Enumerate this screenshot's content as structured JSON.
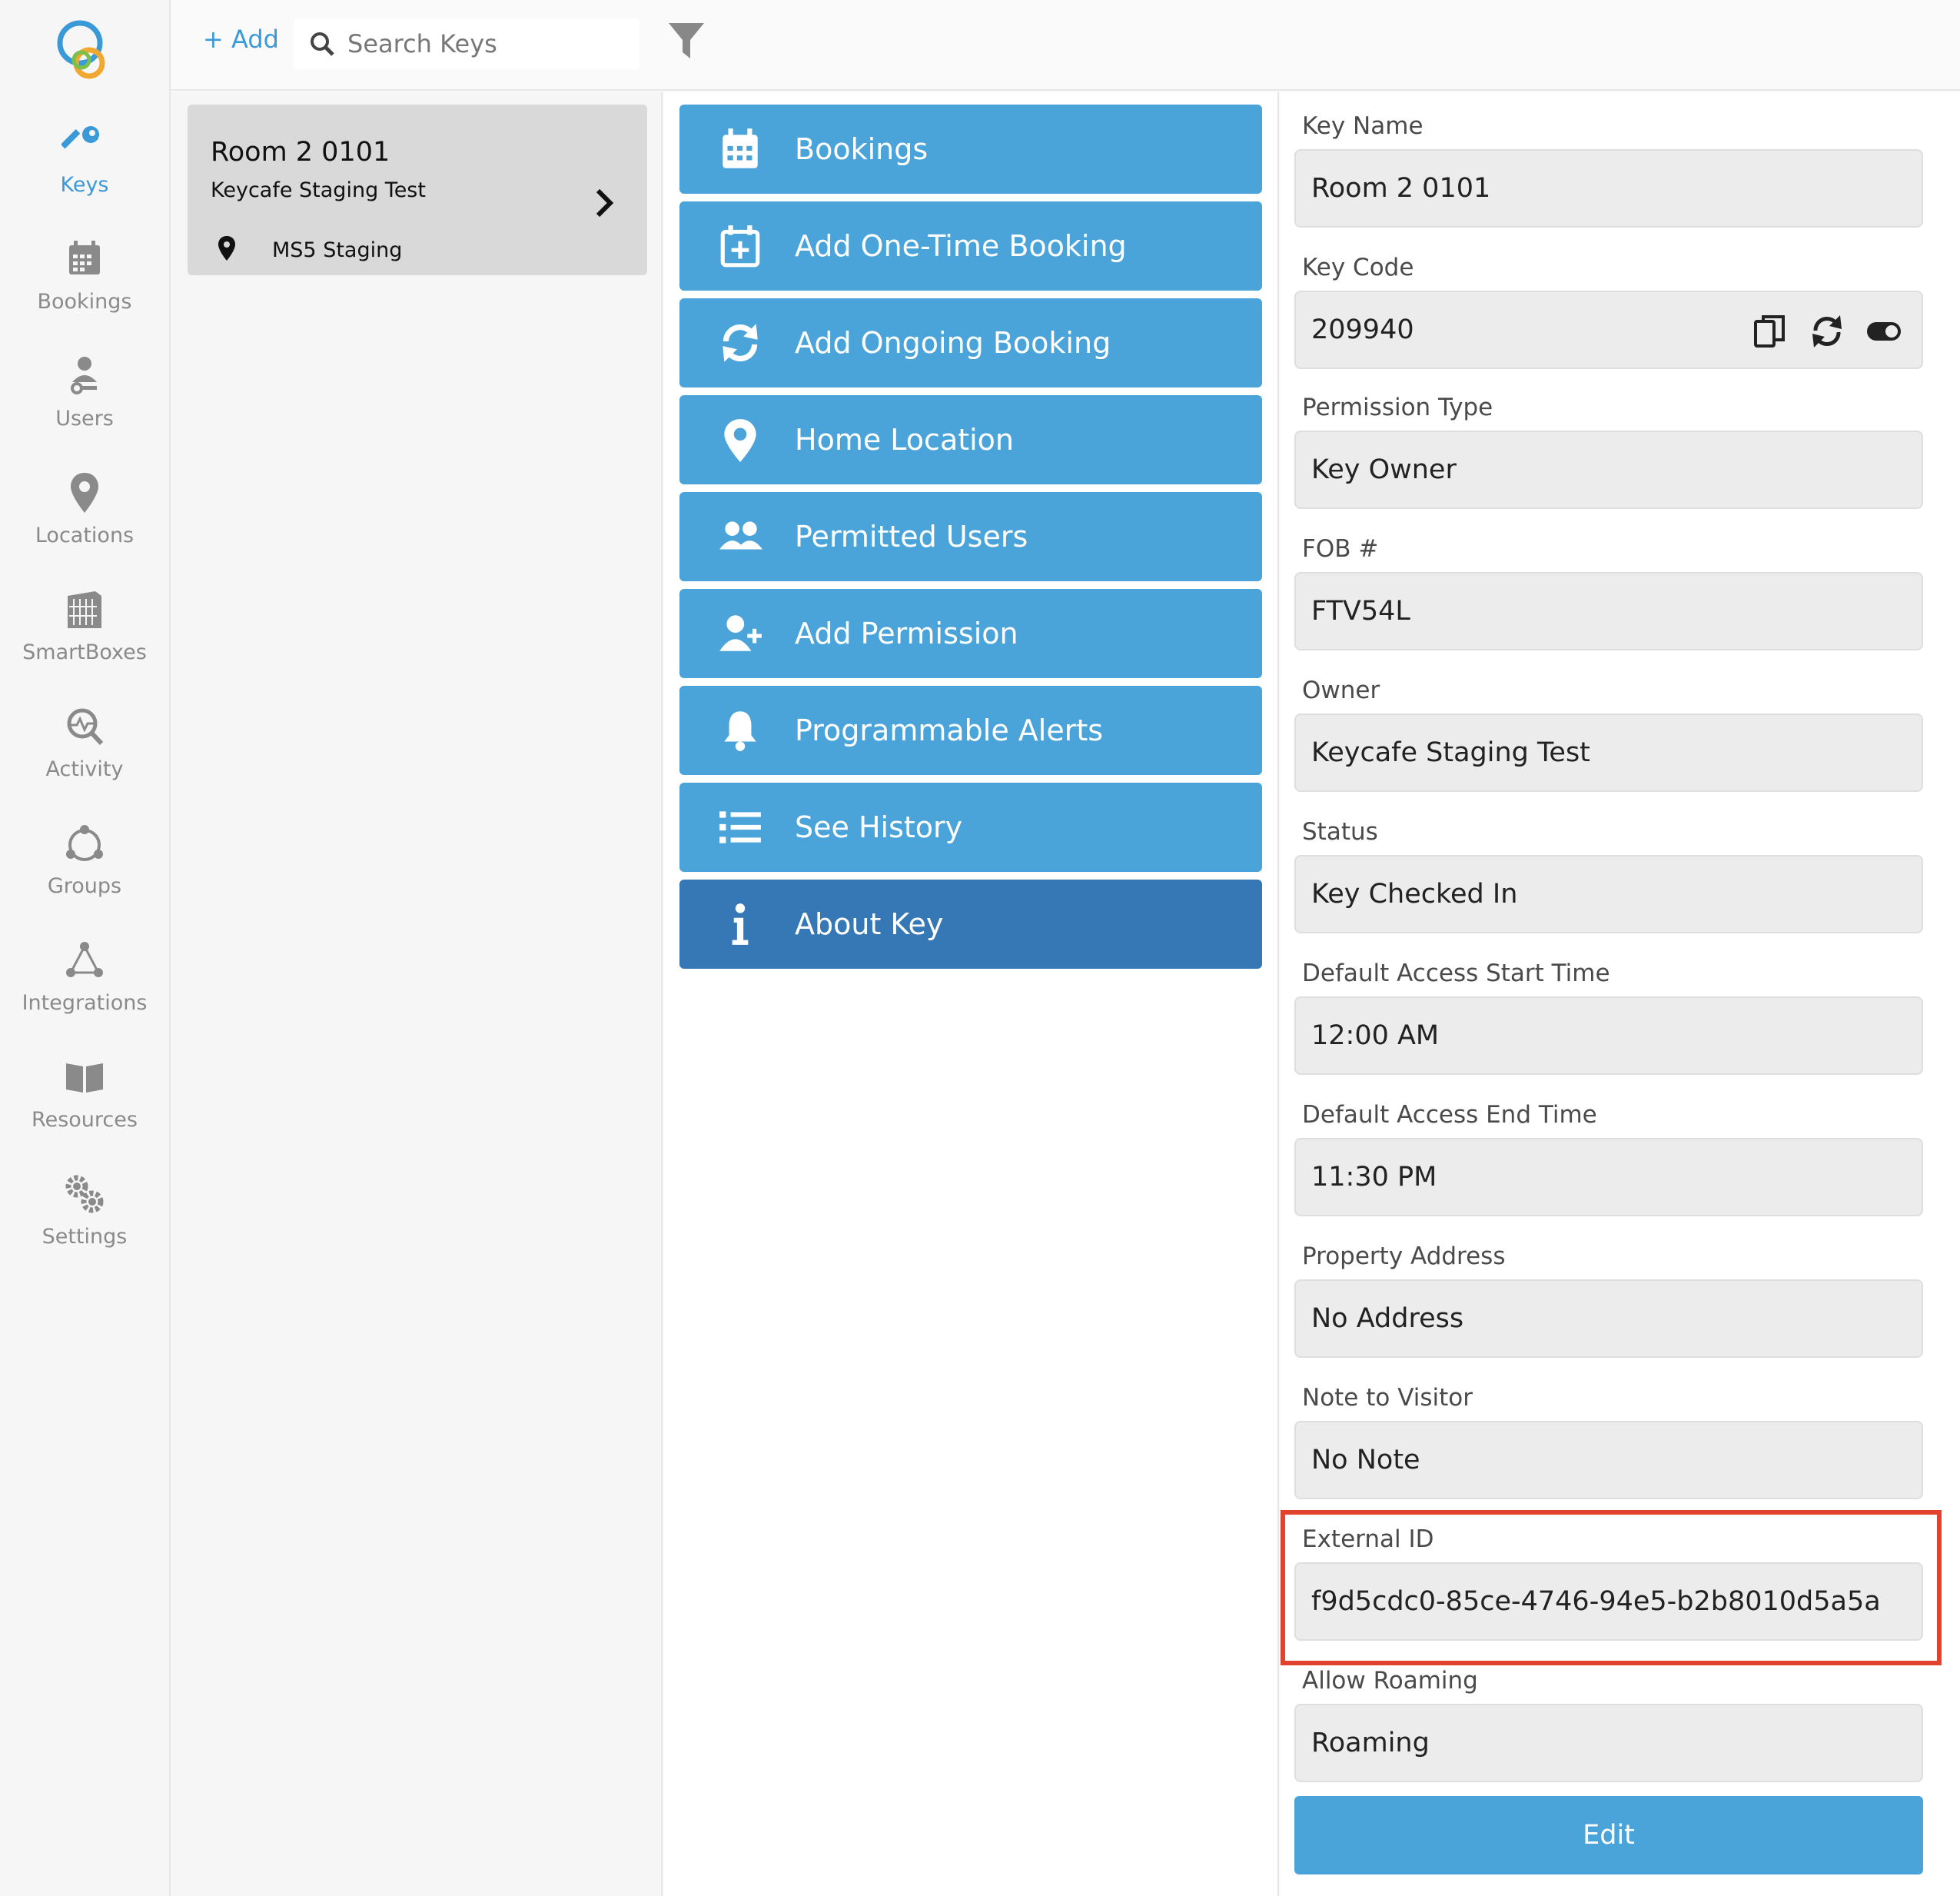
{
  "nav": {
    "items": [
      {
        "label": "Keys",
        "icon": "key-icon",
        "active": true
      },
      {
        "label": "Bookings",
        "icon": "calendar-icon"
      },
      {
        "label": "Users",
        "icon": "users-icon"
      },
      {
        "label": "Locations",
        "icon": "map-pin-icon"
      },
      {
        "label": "SmartBoxes",
        "icon": "smartbox-icon"
      },
      {
        "label": "Activity",
        "icon": "activity-icon"
      },
      {
        "label": "Groups",
        "icon": "groups-icon"
      },
      {
        "label": "Integrations",
        "icon": "integrations-icon"
      },
      {
        "label": "Resources",
        "icon": "book-icon"
      },
      {
        "label": "Settings",
        "icon": "gear-icon"
      }
    ]
  },
  "topbar": {
    "add_label": "+ Add",
    "search_placeholder": "Search Keys"
  },
  "key_list": [
    {
      "title": "Room 2 0101",
      "owner": "Keycafe Staging Test",
      "location": "MS5 Staging"
    }
  ],
  "actions": [
    {
      "label": "Bookings",
      "icon": "calendar-icon"
    },
    {
      "label": "Add One-Time Booking",
      "icon": "calendar-plus-icon"
    },
    {
      "label": "Add Ongoing Booking",
      "icon": "refresh-icon"
    },
    {
      "label": "Home Location",
      "icon": "map-pin-icon"
    },
    {
      "label": "Permitted Users",
      "icon": "users-icon"
    },
    {
      "label": "Add Permission",
      "icon": "user-plus-icon"
    },
    {
      "label": "Programmable Alerts",
      "icon": "bell-icon"
    },
    {
      "label": "See History",
      "icon": "list-icon"
    },
    {
      "label": "About Key",
      "icon": "info-icon",
      "active": true
    }
  ],
  "details": {
    "key_name": {
      "label": "Key Name",
      "value": "Room 2 0101"
    },
    "key_code": {
      "label": "Key Code",
      "value": "209940"
    },
    "permission_type": {
      "label": "Permission Type",
      "value": "Key Owner"
    },
    "fob": {
      "label": "FOB #",
      "value": "FTV54L"
    },
    "owner": {
      "label": "Owner",
      "value": "Keycafe Staging Test"
    },
    "status": {
      "label": "Status",
      "value": "Key Checked In"
    },
    "start_time": {
      "label": "Default Access Start Time",
      "value": "12:00 AM"
    },
    "end_time": {
      "label": "Default Access End Time",
      "value": "11:30 PM"
    },
    "address": {
      "label": "Property Address",
      "value": "No Address"
    },
    "note": {
      "label": "Note to Visitor",
      "value": "No Note"
    },
    "external_id": {
      "label": "External ID",
      "value": "f9d5cdc0-85ce-4746-94e5-b2b8010d5a5a"
    },
    "roaming": {
      "label": "Allow Roaming",
      "value": "Roaming"
    },
    "edit_label": "Edit"
  },
  "colors": {
    "accent": "#4aa4da",
    "active_action": "#3678b6",
    "highlight": "#e1432f"
  }
}
